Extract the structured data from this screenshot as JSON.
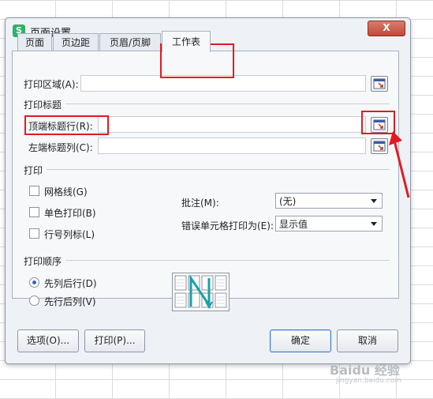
{
  "dialog": {
    "title": "页面设置",
    "close_label": "X",
    "app_icon_letter": "S"
  },
  "tabs": [
    {
      "label": "页面"
    },
    {
      "label": "页边距"
    },
    {
      "label": "页眉/页脚"
    },
    {
      "label": "工作表"
    }
  ],
  "print_area": {
    "label": "打印区域(A):",
    "value": ""
  },
  "print_titles": {
    "section": "打印标题",
    "top_rows_label": "顶端标题行(R):",
    "top_rows_value": "",
    "left_cols_label": "左端标题列(C):",
    "left_cols_value": ""
  },
  "print": {
    "section": "打印",
    "gridlines": "网格线(G)",
    "mono": "单色打印(B)",
    "row_col_headers": "行号列标(L)",
    "comments_label": "批注(M):",
    "comments_value": "(无)",
    "errors_label": "错误单元格打印为(E):",
    "errors_value": "显示值"
  },
  "page_order": {
    "section": "打印顺序",
    "down_then_over": "先列后行(D)",
    "over_then_down": "先行后列(V)",
    "selected": "down_then_over"
  },
  "buttons": {
    "options": "选项(O)...",
    "print": "打印(P)...",
    "ok": "确定",
    "cancel": "取消"
  },
  "watermark": {
    "brand": "Baidu 经验",
    "url": "jingyan.baidu.com"
  },
  "colors": {
    "highlight": "#e11b22",
    "accent": "#2bb36a",
    "arrow": "#e11b22"
  }
}
